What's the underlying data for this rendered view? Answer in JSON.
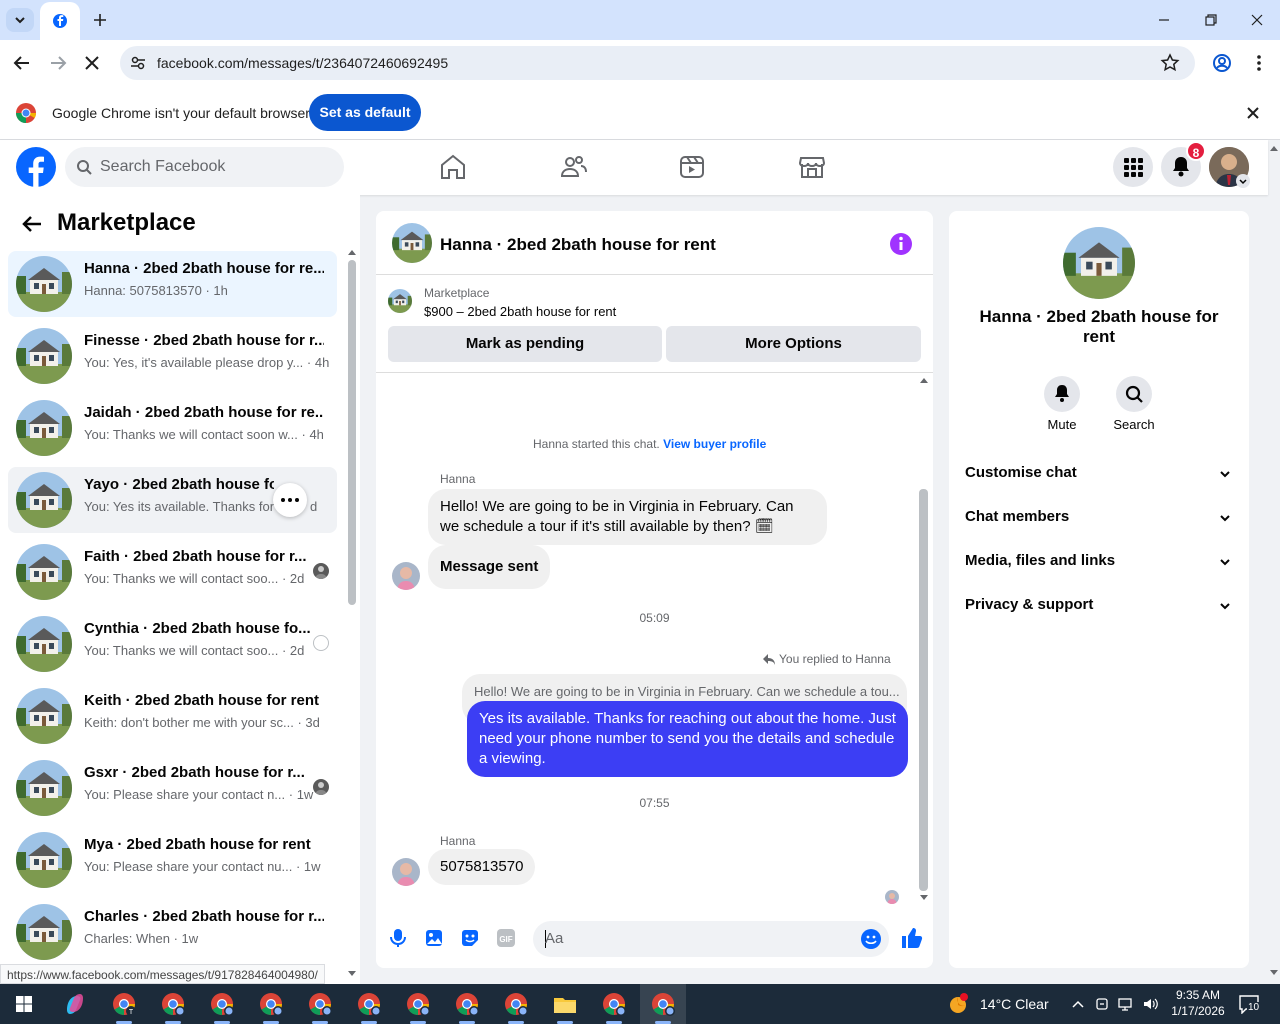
{
  "browser": {
    "url": "facebook.com/messages/t/2364072460692495",
    "infobar_text": "Google Chrome isn't your default browser",
    "set_default_label": "Set as default",
    "status_url": "https://www.facebook.com/messages/t/917828464004980/"
  },
  "header": {
    "search_placeholder": "Search Facebook",
    "notification_count": "8",
    "brand_color": "#0866ff"
  },
  "sidebar": {
    "title": "Marketplace",
    "conversations": [
      {
        "name": "Hanna · 2bed 2bath house for re...",
        "preview": "Hanna: 5075813570 · 1h"
      },
      {
        "name": "Finesse · 2bed 2bath house for r...",
        "preview": "You: Yes, it's available please drop y... · 4h"
      },
      {
        "name": "Jaidah · 2bed 2bath house for re...",
        "preview": "You: Thanks we will contact soon w... · 4h"
      },
      {
        "name": "Yayo · 2bed 2bath house for r",
        "preview": "You: Yes its available. Thanks for r",
        "preview_tail": "d"
      },
      {
        "name": "Faith · 2bed 2bath house for r...",
        "preview": "You: Thanks we will contact soo... · 2d"
      },
      {
        "name": "Cynthia · 2bed 2bath house fo...",
        "preview": "You: Thanks we will contact soo... · 2d"
      },
      {
        "name": "Keith · 2bed 2bath house for rent",
        "preview": "Keith: don't bother me with your sc... · 3d"
      },
      {
        "name": "Gsxr · 2bed 2bath house for r...",
        "preview": "You: Please share your contact n... · 1w"
      },
      {
        "name": "Mya · 2bed 2bath house for rent",
        "preview": "You: Please share your contact nu... · 1w"
      },
      {
        "name": "Charles · 2bed 2bath house for r...",
        "preview": "Charles: When · 1w"
      }
    ]
  },
  "chat": {
    "title": "Hanna · 2bed 2bath house for rent",
    "listing_source": "Marketplace",
    "listing_title": "$900 – 2bed 2bath house for rent",
    "mark_pending_label": "Mark as pending",
    "more_options_label": "More Options",
    "started_text": "Hanna started this chat.",
    "buyer_profile_link": "View buyer profile",
    "sender_1": "Hanna",
    "msg_1": "Hello! We are going to be in Virginia in February. Can we schedule a tour if it's still available by then? 🗓",
    "msg_2": "Message sent",
    "time_1": "05:09",
    "replied_label": "You replied to Hanna",
    "quoted_text": "Hello! We are going to be in Virginia in February. Can we schedule a tou...",
    "msg_3": "Yes its available. Thanks for reaching out about the home. Just need your phone number to send you the details and schedule a viewing.",
    "time_2": "07:55",
    "sender_2": "Hanna",
    "msg_4": "5075813570",
    "composer_placeholder": "Aa",
    "outgoing_color": "#3c3ef4"
  },
  "details": {
    "title": "Hanna · 2bed 2bath house for rent",
    "mute_label": "Mute",
    "search_label": "Search",
    "sections": [
      "Customise chat",
      "Chat members",
      "Media, files and links",
      "Privacy & support"
    ]
  },
  "taskbar": {
    "weather": "14°C  Clear",
    "time": "9:35 AM",
    "date": "1/17/2026",
    "notif_count": "10"
  }
}
